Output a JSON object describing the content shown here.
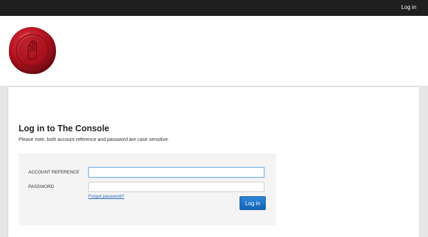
{
  "topbar": {
    "login_label": "Log in"
  },
  "header": {
    "logo_icon": "wax-seal-hand-icon"
  },
  "main": {
    "title": "Log in to The Console",
    "note": "Please note, both account reference and password are case sensitive."
  },
  "form": {
    "account_label": "ACCOUNT REFERENCE",
    "account_value": "",
    "password_label": "PASSWORD",
    "password_value": "",
    "forgot_label": "Forgot password?",
    "submit_label": "Log in"
  },
  "colors": {
    "topbar": "#1f1f1f",
    "seal": "#b3121e",
    "button": "#1a6cc4",
    "link": "#2a66b4",
    "panel": "#f4f4f4"
  }
}
